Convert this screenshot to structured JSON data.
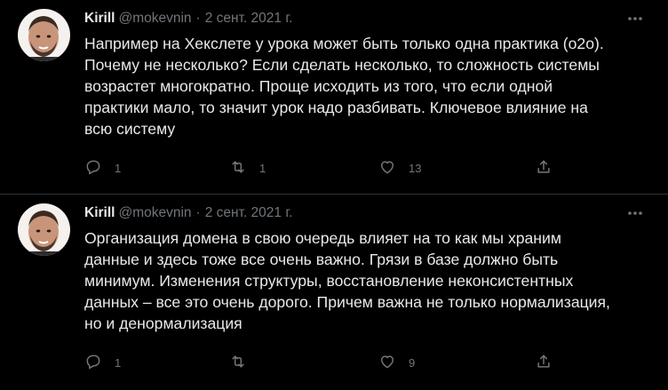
{
  "tweets": [
    {
      "author_name": "Kirill",
      "handle": "@mokevnin",
      "separator": "·",
      "date": "2 сент. 2021 г.",
      "text": "Например на Хекслете у урока может быть только одна практика (o2o).\nПочему не несколько? Если сделать несколько, то сложность системы\nвозрастет многократно. Проще исходить из того, что если одной\nпрактики мало, то значит урок надо разбивать. Ключевое влияние на\nвсю систему",
      "replies": "1",
      "retweets": "1",
      "likes": "13"
    },
    {
      "author_name": "Kirill",
      "handle": "@mokevnin",
      "separator": "·",
      "date": "2 сент. 2021 г.",
      "text": "Организация домена в свою очередь влияет на то как мы храним\nданные и здесь тоже все очень важно. Грязи в базе должно быть\nминимум. Изменения структуры, восстановление неконсистентных\nданных – все это очень дорого. Причем важна не только нормализация,\nно и денормализация",
      "replies": "1",
      "retweets": "",
      "likes": "9"
    }
  ],
  "icons": {
    "more": "more-horizontal-icon",
    "reply": "reply-bubble-icon",
    "retweet": "retweet-arrows-icon",
    "like": "heart-icon",
    "share": "share-upload-icon"
  },
  "colors": {
    "background": "#000000",
    "text_primary": "#e7e9ea",
    "text_secondary": "#71767b",
    "divider": "#2f3336"
  }
}
